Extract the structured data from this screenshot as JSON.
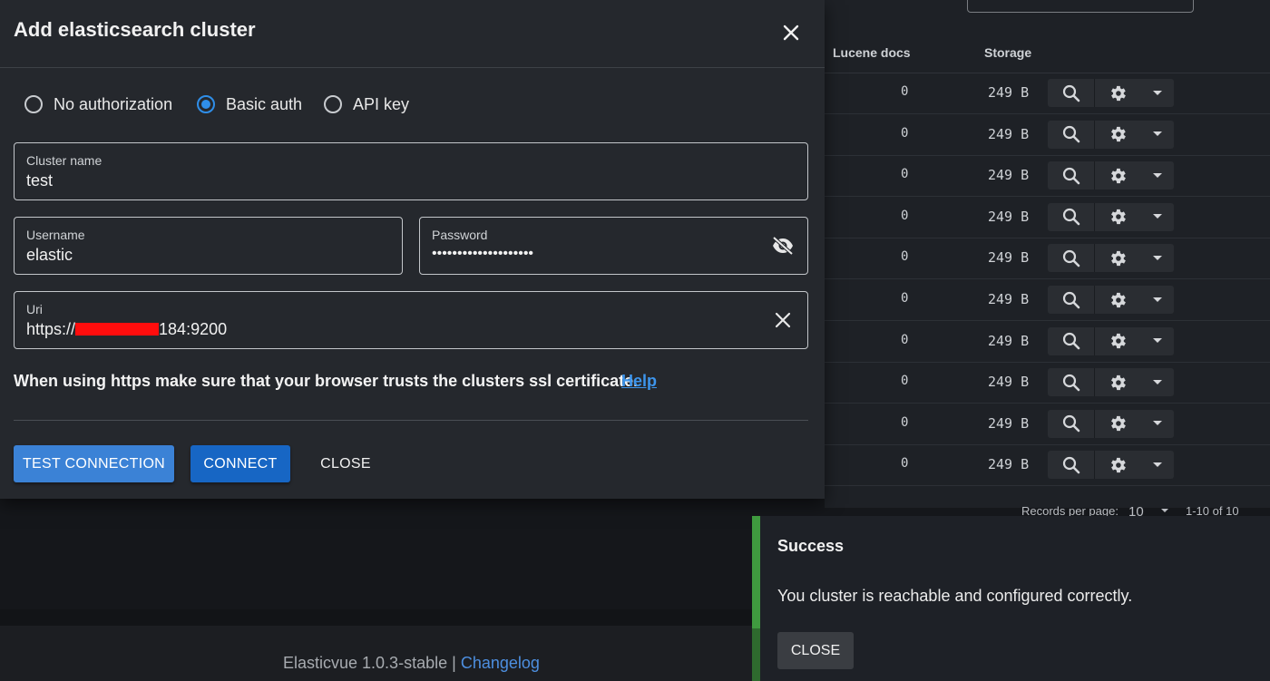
{
  "dialog": {
    "title": "Add elasticsearch cluster",
    "auth_options": [
      {
        "label": "No authorization",
        "checked": false
      },
      {
        "label": "Basic auth",
        "checked": true
      },
      {
        "label": "API key",
        "checked": false
      }
    ],
    "cluster_name": {
      "label": "Cluster name",
      "value": "test"
    },
    "username": {
      "label": "Username",
      "value": "elastic"
    },
    "password": {
      "label": "Password",
      "value": "••••••••••••••••••••"
    },
    "uri": {
      "label": "Uri",
      "value_prefix": "https://",
      "value_suffix": "184:9200"
    },
    "note": "When using https make sure that your browser trusts the clusters ssl certificate.",
    "help_link": "Help",
    "buttons": {
      "test": "TEST CONNECTION",
      "connect": "CONNECT",
      "close": "CLOSE"
    }
  },
  "table": {
    "headers": {
      "docs": "Lucene docs",
      "storage": "Storage"
    },
    "rows": [
      {
        "docs": "0",
        "storage": "249 B"
      },
      {
        "docs": "0",
        "storage": "249 B"
      },
      {
        "docs": "0",
        "storage": "249 B"
      },
      {
        "docs": "0",
        "storage": "249 B"
      },
      {
        "docs": "0",
        "storage": "249 B"
      },
      {
        "docs": "0",
        "storage": "249 B"
      },
      {
        "docs": "0",
        "storage": "249 B"
      },
      {
        "docs": "0",
        "storage": "249 B"
      },
      {
        "docs": "0",
        "storage": "249 B"
      },
      {
        "docs": "0",
        "storage": "249 B"
      }
    ],
    "pagination": {
      "label": "Records per page:",
      "per_page": "10",
      "range": "1-10 of 10"
    }
  },
  "snackbar": {
    "title": "Success",
    "message": "You cluster is reachable and configured correctly.",
    "close_label": "CLOSE"
  },
  "footer": {
    "version": "Elasticvue 1.0.3-stable",
    "separator": "|",
    "changelog": "Changelog"
  },
  "colors": {
    "accent": "#2f8ee8",
    "success": "#3f9a3f",
    "primary_button": "#1766c4"
  },
  "icons": [
    "close-icon",
    "eye-off-icon",
    "clear-icon",
    "search-icon",
    "gear-icon",
    "caret-down-icon"
  ]
}
